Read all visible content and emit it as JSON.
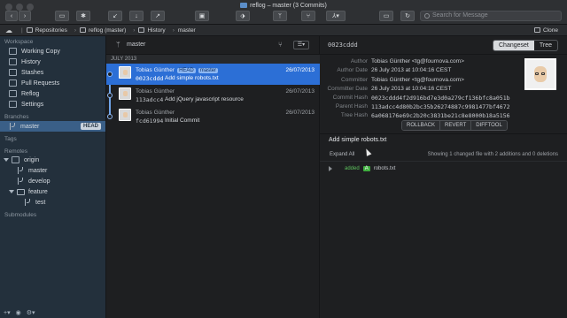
{
  "window": {
    "title": "reflog – master (3 Commits)"
  },
  "toolbar": {
    "search_placeholder": "Search for Message"
  },
  "navbar": {
    "crumbs": [
      "Repositories",
      "reflog (master)",
      "History",
      "master"
    ],
    "clone_label": "Clone"
  },
  "sidebar": {
    "workspace_header": "Workspace",
    "workspace_items": [
      "Working Copy",
      "History",
      "Stashes",
      "Pull Requests",
      "Reflog",
      "Settings"
    ],
    "branches_header": "Branches",
    "branch": "master",
    "head_badge": "HEAD",
    "tags_header": "Tags",
    "remotes_header": "Remotes",
    "remote_name": "origin",
    "remote_branches": [
      "master",
      "develop"
    ],
    "remote_folder": "feature",
    "remote_folder_items": [
      "test"
    ],
    "submodules_header": "Submodules"
  },
  "list": {
    "branch": "master",
    "month": "JULY 2013",
    "commits": [
      {
        "author": "Tobias Günther",
        "tags": [
          "HEAD",
          "master"
        ],
        "date": "26/07/2013",
        "hash": "0023cddd",
        "message": "Add simple robots.txt"
      },
      {
        "author": "Tobias Günther",
        "tags": [],
        "date": "26/07/2013",
        "hash": "113adcc4",
        "message": "Add jQuery javascript resource"
      },
      {
        "author": "Tobias Günther",
        "tags": [],
        "date": "26/07/2013",
        "hash": "fcd61994",
        "message": "Initial Commit"
      }
    ]
  },
  "detail": {
    "hash": "0023cddd",
    "view_tabs": [
      "Changeset",
      "Tree"
    ],
    "meta": [
      {
        "key": "Author",
        "value": "Tobias Günther <tg@fournova.com>"
      },
      {
        "key": "Author Date",
        "value": "26 July 2013 at 10:04:16 CEST"
      },
      {
        "key": "Committer",
        "value": "Tobias Günther <tg@fournova.com>"
      },
      {
        "key": "Committer Date",
        "value": "26 July 2013 at 10:04:16 CEST"
      },
      {
        "key": "Commit Hash",
        "value": "0023cddd4f2d916bd7e3d0a279cf136bfc8a051b"
      },
      {
        "key": "Parent Hash",
        "value": "113adcc4d80b2bc35b26274887c9981477bf4672"
      },
      {
        "key": "Tree Hash",
        "value": "6a068176e69c2b20c3831be21c8e8000b18a5156"
      }
    ],
    "actions": [
      "ROLLBACK",
      "REVERT",
      "DIFFTOOL"
    ],
    "subject": "Add simple robots.txt",
    "expand_all": "Expand All",
    "showing": "Showing 1 changed file with 2 additions and 0 deletions",
    "file": {
      "status": "added",
      "badge": "A",
      "name": "robots.txt"
    }
  }
}
